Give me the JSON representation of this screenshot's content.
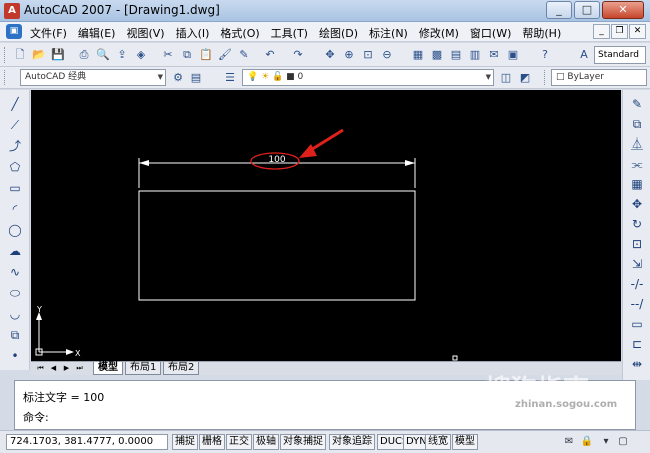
{
  "window": {
    "title": "AutoCAD 2007 - [Drawing1.dwg]",
    "app_icon": "autocad-logo-icon"
  },
  "menu": {
    "items": [
      "文件(F)",
      "编辑(E)",
      "视图(V)",
      "插入(I)",
      "格式(O)",
      "工具(T)",
      "绘图(D)",
      "标注(N)",
      "修改(M)",
      "窗口(W)",
      "帮助(H)"
    ]
  },
  "toolbar": {
    "text_style": "Standard",
    "workspace": "AutoCAD 经典",
    "layer": "0",
    "color": "ByLayer"
  },
  "drawing": {
    "dimension_text": "100",
    "ucs_x": "X",
    "ucs_y": "Y"
  },
  "layout_tabs": [
    "模型",
    "布局1",
    "布局2"
  ],
  "command": {
    "history": "标注文字 = 100",
    "prompt": "命令:"
  },
  "status": {
    "coordinates": "724.1703, 381.4777, 0.0000",
    "buttons": [
      "捕捉",
      "栅格",
      "正交",
      "极轴",
      "对象捕捉",
      "对象追踪",
      "DUCS",
      "DYN",
      "线宽",
      "模型"
    ]
  },
  "watermark": {
    "text": "搜狗指南",
    "url": "zhinan.sogou.com"
  },
  "colors": {
    "canvas": "#000000",
    "highlight": "#e0201a",
    "geometry": "#ffffff"
  }
}
